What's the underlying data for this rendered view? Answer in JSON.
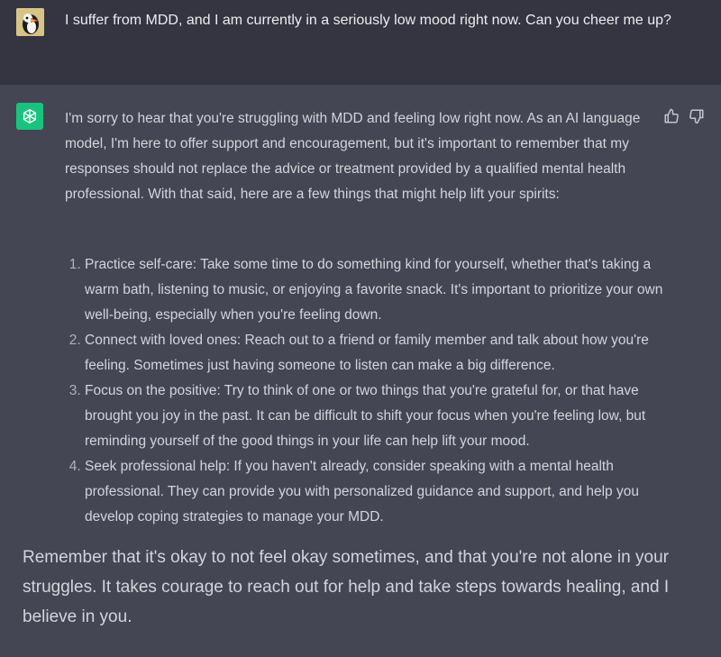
{
  "user": {
    "message": "I suffer from MDD, and I am currently in a seriously low mood right now. Can you cheer me up?"
  },
  "assistant": {
    "intro": "I'm sorry to hear that you're struggling with MDD and feeling low right now. As an AI language model, I'm here to offer support and encouragement, but it's important to remember that my responses should not replace the advice or treatment provided by a qualified mental health professional. With that said, here are a few things that might help lift your spirits:",
    "tips": [
      "Practice self-care: Take some time to do something kind for yourself, whether that's taking a warm bath, listening to music, or enjoying a favorite snack. It's important to prioritize your own well-being, especially when you're feeling down.",
      "Connect with loved ones: Reach out to a friend or family member and talk about how you're feeling. Sometimes just having someone to listen can make a big difference.",
      "Focus on the positive: Try to think of one or two things that you're grateful for, or that have brought you joy in the past. It can be difficult to shift your focus when you're feeling low, but reminding yourself of the good things in your life can help lift your mood.",
      "Seek professional help: If you haven't already, consider speaking with a mental health professional. They can provide you with personalized guidance and support, and help you develop coping strategies to manage your MDD."
    ],
    "outro": "Remember that it's okay to not feel okay sometimes, and that you're not alone in your struggles. It takes courage to reach out for help and take steps towards healing, and I believe in you."
  },
  "icons": {
    "user_avatar": "puffin-avatar-icon",
    "assistant_avatar": "openai-logo-icon",
    "like": "thumbs-up-icon",
    "dislike": "thumbs-down-icon"
  },
  "colors": {
    "user_bg": "#343541",
    "assistant_bg": "#444654",
    "avatar_green": "#19c37d"
  }
}
